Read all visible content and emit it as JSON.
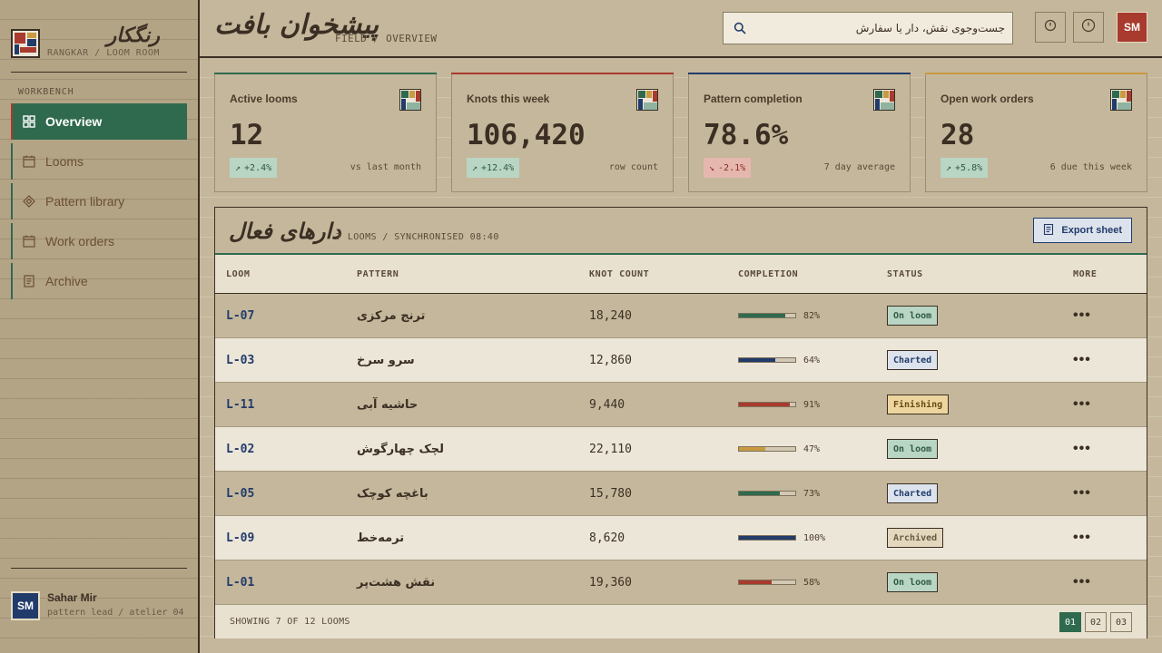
{
  "brand": {
    "title": "رنگکار",
    "subtitle": "RANGKAR / LOOM ROOM"
  },
  "sidebar": {
    "section_label": "WORKBENCH",
    "items": [
      {
        "label": "Overview",
        "icon": "grid-icon",
        "active": true
      },
      {
        "label": "Looms",
        "icon": "calendar-icon",
        "active": false
      },
      {
        "label": "Pattern library",
        "icon": "diamond-icon",
        "active": false
      },
      {
        "label": "Work orders",
        "icon": "calendar-icon",
        "active": false
      },
      {
        "label": "Archive",
        "icon": "document-icon",
        "active": false
      }
    ],
    "user": {
      "initials": "SM",
      "name": "Sahar Mir",
      "role": "pattern lead / atelier 04"
    }
  },
  "header": {
    "title": "پیشخوان بافت",
    "breadcrumb": "FIELD / OVERVIEW",
    "search_placeholder": "جست‌وجوی نقش، دار یا سفارش",
    "avatar_initials": "SM"
  },
  "colors": {
    "green": "#2f6a4e",
    "red": "#a83a2e",
    "navy": "#213b6b",
    "ochre": "#c99a3f"
  },
  "stats": [
    {
      "title": "Active looms",
      "value": "12",
      "delta": "+2.4%",
      "direction": "up",
      "note": "vs last month",
      "accent": "#2f6a4e"
    },
    {
      "title": "Knots this week",
      "value": "106,420",
      "delta": "+12.4%",
      "direction": "up",
      "note": "row count",
      "accent": "#a83a2e"
    },
    {
      "title": "Pattern completion",
      "value": "78.6%",
      "delta": "-2.1%",
      "direction": "down",
      "note": "7 day average",
      "accent": "#213b6b"
    },
    {
      "title": "Open work orders",
      "value": "28",
      "delta": "+5.8%",
      "direction": "up",
      "note": "6 due this week",
      "accent": "#c99a3f"
    }
  ],
  "table": {
    "title": "دارهای فعال",
    "meta": "7 LOOMS / SYNCHRONISED 08:40",
    "export_label": "Export sheet",
    "columns": [
      "LOOM",
      "PATTERN",
      "KNOT COUNT",
      "COMPLETION",
      "STATUS",
      "MORE"
    ],
    "rows": [
      {
        "loom": "L-07",
        "pattern": "ترنج مرکزی",
        "knots": "18,240",
        "completion": 82,
        "completion_label": "82%",
        "status": "On loom",
        "bar_color": "#2f6a4e"
      },
      {
        "loom": "L-03",
        "pattern": "سرو سرخ",
        "knots": "12,860",
        "completion": 64,
        "completion_label": "64%",
        "status": "Charted",
        "bar_color": "#213b6b"
      },
      {
        "loom": "L-11",
        "pattern": "حاشیه آبی",
        "knots": "9,440",
        "completion": 91,
        "completion_label": "91%",
        "status": "Finishing",
        "bar_color": "#a83a2e"
      },
      {
        "loom": "L-02",
        "pattern": "لچک چهارگوش",
        "knots": "22,110",
        "completion": 47,
        "completion_label": "47%",
        "status": "On loom",
        "bar_color": "#c99a3f"
      },
      {
        "loom": "L-05",
        "pattern": "باغچه کوچک",
        "knots": "15,780",
        "completion": 73,
        "completion_label": "73%",
        "status": "Charted",
        "bar_color": "#2f6a4e"
      },
      {
        "loom": "L-09",
        "pattern": "ترمه‌خط",
        "knots": "8,620",
        "completion": 100,
        "completion_label": "100%",
        "status": "Archived",
        "bar_color": "#213b6b"
      },
      {
        "loom": "L-01",
        "pattern": "نقش هشت‌پر",
        "knots": "19,360",
        "completion": 58,
        "completion_label": "58%",
        "status": "On loom",
        "bar_color": "#a83a2e"
      }
    ],
    "more_label": "•••",
    "footer": "SHOWING 7 OF 12 LOOMS",
    "pages": [
      "01",
      "02",
      "03"
    ],
    "current_page": "01"
  },
  "status_styles": {
    "On loom": {
      "bg": "#b9d5c4",
      "fg": "#2f5a44"
    },
    "Charted": {
      "bg": "#dde3ec",
      "fg": "#213b6b"
    },
    "Finishing": {
      "bg": "#ecd59e",
      "fg": "#6a4a12"
    },
    "Archived": {
      "bg": "#e3d7bd",
      "fg": "#6a5a44"
    }
  }
}
